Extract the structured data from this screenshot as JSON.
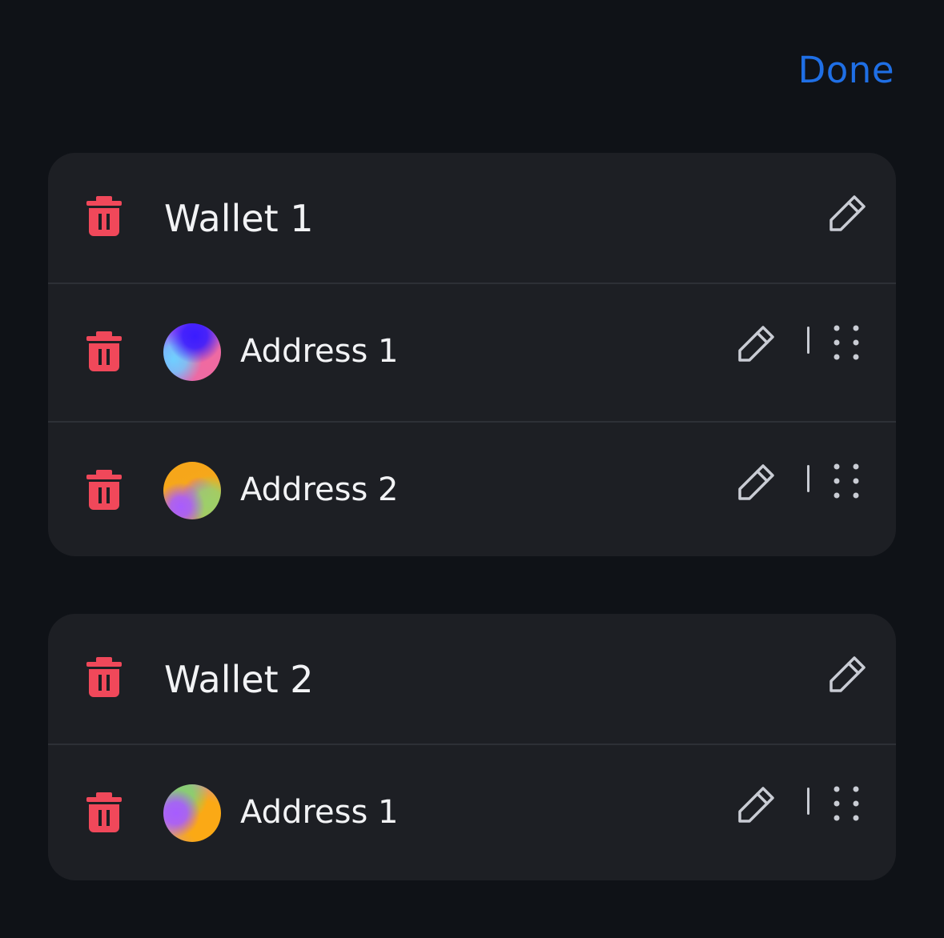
{
  "header": {
    "done_label": "Done"
  },
  "colors": {
    "accent": "#1f6fe5",
    "delete": "#f0485a",
    "icon": "#c9ccd4",
    "card": "#1d1f24",
    "background": "#0f1217"
  },
  "wallets": [
    {
      "name": "Wallet 1",
      "addresses": [
        {
          "name": "Address 1",
          "avatar": "gradient-blue-pink"
        },
        {
          "name": "Address 2",
          "avatar": "gradient-orange-purple-green"
        }
      ]
    },
    {
      "name": "Wallet 2",
      "addresses": [
        {
          "name": "Address 1",
          "avatar": "gradient-purple-green-orange"
        }
      ]
    }
  ],
  "icons": {
    "delete": "trash-icon",
    "edit": "pencil-icon",
    "reorder": "drag-handle-icon"
  }
}
